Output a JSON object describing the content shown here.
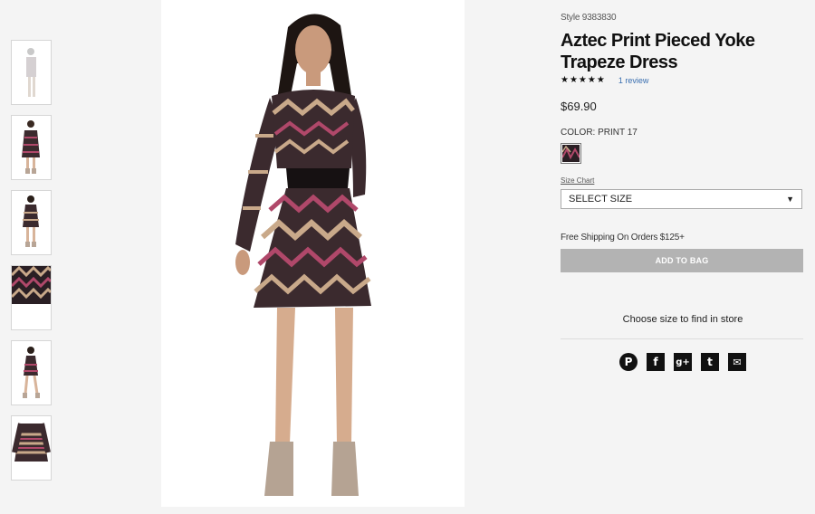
{
  "product": {
    "style_number": "Style 9383830",
    "title": "Aztec Print Pieced Yoke Trapeze Dress",
    "stars": "★★★★★",
    "review_link": "1 review",
    "price": "$69.90",
    "color_label": "COLOR: PRINT 17",
    "size_chart": "Size Chart",
    "size_select": "SELECT SIZE",
    "shipping_note": "Free Shipping On Orders $125+",
    "add_to_bag": "ADD TO BAG",
    "store_note": "Choose size to find in store"
  },
  "social": {
    "pinterest": "P",
    "facebook": "f",
    "googleplus": "g+",
    "twitter": "t",
    "email": "✉"
  },
  "colors": {
    "dress_dark": "#2a1f24",
    "dress_pink": "#b0486a",
    "dress_tan": "#c9a98a",
    "button_bg": "#b3b3b3",
    "link": "#3a6fb0"
  }
}
